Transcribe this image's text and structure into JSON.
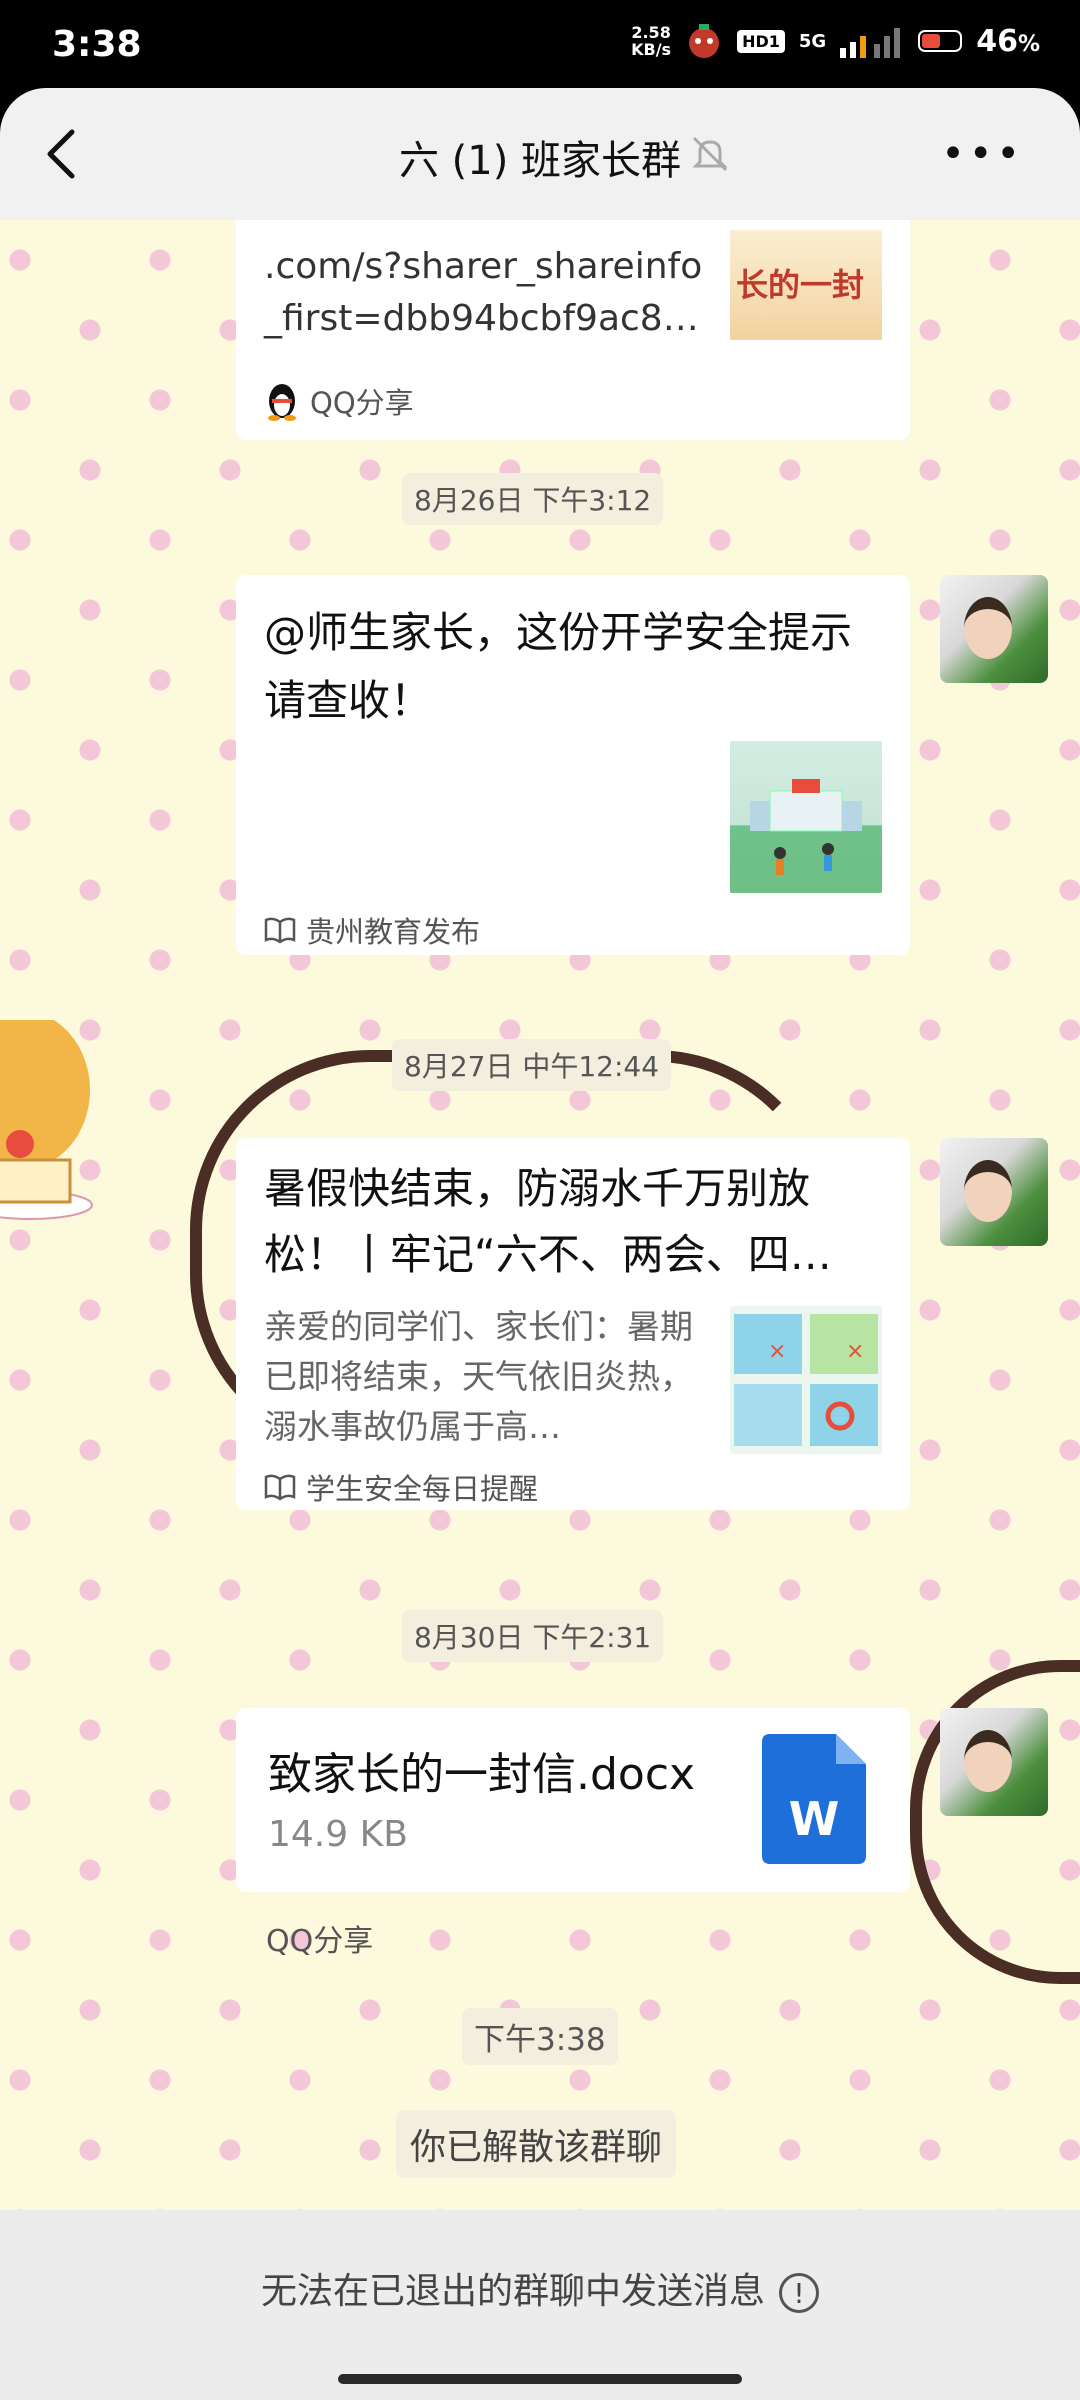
{
  "status_bar": {
    "time": "3:38",
    "speed_value": "2.58",
    "speed_unit": "KB/s",
    "hd": "HD1",
    "network": "5G",
    "battery": "46",
    "battery_unit": "%"
  },
  "header": {
    "title": "六 (1) 班家长群"
  },
  "messages": {
    "m0": {
      "link_line1": ".com/s?sharer_shareinfo",
      "link_line2": "_first=dbb94bcbf9ac8…",
      "source": "QQ分享",
      "thumb_text": "长的一封"
    },
    "ts1": "8月26日 下午3:12",
    "m1": {
      "title": "@师生家长，这份开学安全提示请查收！",
      "source": "贵州教育发布"
    },
    "ts2": "8月27日 中午12:44",
    "m2": {
      "title": "暑假快结束，防溺水千万别放松！丨牢记“六不、两会、四…",
      "desc": "亲爱的同学们、家长们：暑期已即将结束，天气依旧炎热，溺水事故仍属于高…",
      "source": "学生安全每日提醒"
    },
    "ts3": "8月30日 下午2:31",
    "m3": {
      "file_name": "致家长的一封信.docx",
      "file_size": "14.9 KB",
      "file_icon_letter": "W",
      "source": "QQ分享"
    },
    "ts4": "下午3:38",
    "system_notice": "你已解散该群聊"
  },
  "footer": {
    "notice": "无法在已退出的群聊中发送消息",
    "icon_symbol": "!"
  },
  "colors": {
    "chat_bg": "#fdf9dc",
    "dots": "#f4c7d8",
    "word_icon": "#1e6fd9"
  }
}
